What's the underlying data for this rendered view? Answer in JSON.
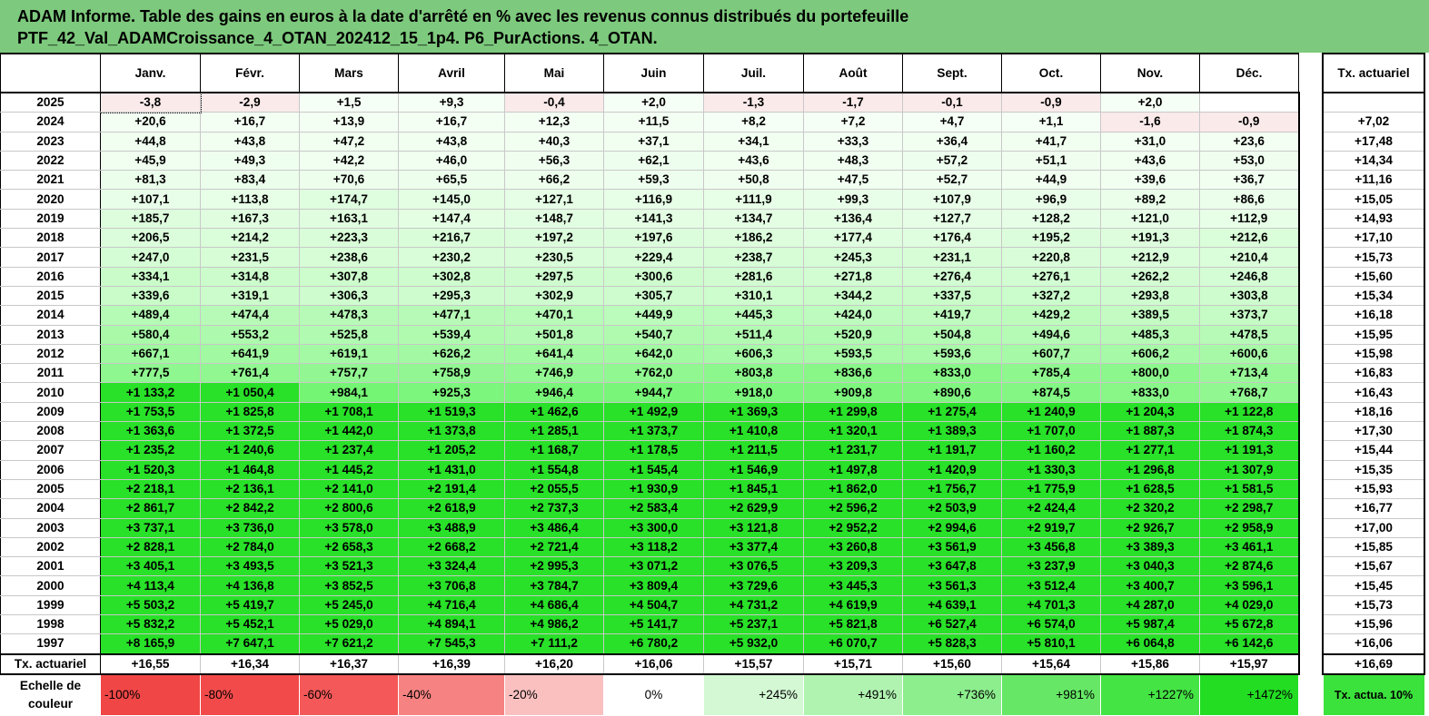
{
  "title": {
    "line1": "ADAM Informe. Table des gains en euros à la date d'arrêté en % avec les revenus connus distribués du portefeuille",
    "line2": "PTF_42_Val_ADAMCroissance_4_OTAN_202412_15_1p4. P6_PurActions. 4_OTAN."
  },
  "months": [
    "Janv.",
    "Févr.",
    "Mars",
    "Avril",
    "Mai",
    "Juin",
    "Juil.",
    "Août",
    "Sept.",
    "Oct.",
    "Nov.",
    "Déc."
  ],
  "rate_header": "Tx. actuariel",
  "rows": [
    {
      "year": "2025",
      "values": [
        "-3,8",
        "-2,9",
        "+1,5",
        "+9,3",
        "-0,4",
        "+2,0",
        "-1,3",
        "-1,7",
        "-0,1",
        "-0,9",
        "+2,0",
        ""
      ],
      "rate": ""
    },
    {
      "year": "2024",
      "values": [
        "+20,6",
        "+16,7",
        "+13,9",
        "+16,7",
        "+12,3",
        "+11,5",
        "+8,2",
        "+7,2",
        "+4,7",
        "+1,1",
        "-1,6",
        "-0,9"
      ],
      "rate": "+7,02"
    },
    {
      "year": "2023",
      "values": [
        "+44,8",
        "+43,8",
        "+47,2",
        "+43,8",
        "+40,3",
        "+37,1",
        "+34,1",
        "+33,3",
        "+36,4",
        "+41,7",
        "+31,0",
        "+23,6"
      ],
      "rate": "+17,48"
    },
    {
      "year": "2022",
      "values": [
        "+45,9",
        "+49,3",
        "+42,2",
        "+46,0",
        "+56,3",
        "+62,1",
        "+43,6",
        "+48,3",
        "+57,2",
        "+51,1",
        "+43,6",
        "+53,0"
      ],
      "rate": "+14,34"
    },
    {
      "year": "2021",
      "values": [
        "+81,3",
        "+83,4",
        "+70,6",
        "+65,5",
        "+66,2",
        "+59,3",
        "+50,8",
        "+47,5",
        "+52,7",
        "+44,9",
        "+39,6",
        "+36,7"
      ],
      "rate": "+11,16"
    },
    {
      "year": "2020",
      "values": [
        "+107,1",
        "+113,8",
        "+174,7",
        "+145,0",
        "+127,1",
        "+116,9",
        "+111,9",
        "+99,3",
        "+107,9",
        "+96,9",
        "+89,2",
        "+86,6"
      ],
      "rate": "+15,05"
    },
    {
      "year": "2019",
      "values": [
        "+185,7",
        "+167,3",
        "+163,1",
        "+147,4",
        "+148,7",
        "+141,3",
        "+134,7",
        "+136,4",
        "+127,7",
        "+128,2",
        "+121,0",
        "+112,9"
      ],
      "rate": "+14,93"
    },
    {
      "year": "2018",
      "values": [
        "+206,5",
        "+214,2",
        "+223,3",
        "+216,7",
        "+197,2",
        "+197,6",
        "+186,2",
        "+177,4",
        "+176,4",
        "+195,2",
        "+191,3",
        "+212,6"
      ],
      "rate": "+17,10"
    },
    {
      "year": "2017",
      "values": [
        "+247,0",
        "+231,5",
        "+238,6",
        "+230,2",
        "+230,5",
        "+229,4",
        "+238,7",
        "+245,3",
        "+231,1",
        "+220,8",
        "+212,9",
        "+210,4"
      ],
      "rate": "+15,73"
    },
    {
      "year": "2016",
      "values": [
        "+334,1",
        "+314,8",
        "+307,8",
        "+302,8",
        "+297,5",
        "+300,6",
        "+281,6",
        "+271,8",
        "+276,4",
        "+276,1",
        "+262,2",
        "+246,8"
      ],
      "rate": "+15,60"
    },
    {
      "year": "2015",
      "values": [
        "+339,6",
        "+319,1",
        "+306,3",
        "+295,3",
        "+302,9",
        "+305,7",
        "+310,1",
        "+344,2",
        "+337,5",
        "+327,2",
        "+293,8",
        "+303,8"
      ],
      "rate": "+15,34"
    },
    {
      "year": "2014",
      "values": [
        "+489,4",
        "+474,4",
        "+478,3",
        "+477,1",
        "+470,1",
        "+449,9",
        "+445,3",
        "+424,0",
        "+419,7",
        "+429,2",
        "+389,5",
        "+373,7"
      ],
      "rate": "+16,18"
    },
    {
      "year": "2013",
      "values": [
        "+580,4",
        "+553,2",
        "+525,8",
        "+539,4",
        "+501,8",
        "+540,7",
        "+511,4",
        "+520,9",
        "+504,8",
        "+494,6",
        "+485,3",
        "+478,5"
      ],
      "rate": "+15,95"
    },
    {
      "year": "2012",
      "values": [
        "+667,1",
        "+641,9",
        "+619,1",
        "+626,2",
        "+641,4",
        "+642,0",
        "+606,3",
        "+593,5",
        "+593,6",
        "+607,7",
        "+606,2",
        "+600,6"
      ],
      "rate": "+15,98"
    },
    {
      "year": "2011",
      "values": [
        "+777,5",
        "+761,4",
        "+757,7",
        "+758,9",
        "+746,9",
        "+762,0",
        "+803,8",
        "+836,6",
        "+833,0",
        "+785,4",
        "+800,0",
        "+713,4"
      ],
      "rate": "+16,83"
    },
    {
      "year": "2010",
      "values": [
        "+1 133,2",
        "+1 050,4",
        "+984,1",
        "+925,3",
        "+946,4",
        "+944,7",
        "+918,0",
        "+909,8",
        "+890,6",
        "+874,5",
        "+833,0",
        "+768,7"
      ],
      "rate": "+16,43"
    },
    {
      "year": "2009",
      "values": [
        "+1 753,5",
        "+1 825,8",
        "+1 708,1",
        "+1 519,3",
        "+1 462,6",
        "+1 492,9",
        "+1 369,3",
        "+1 299,8",
        "+1 275,4",
        "+1 240,9",
        "+1 204,3",
        "+1 122,8"
      ],
      "rate": "+18,16"
    },
    {
      "year": "2008",
      "values": [
        "+1 363,6",
        "+1 372,5",
        "+1 442,0",
        "+1 373,8",
        "+1 285,1",
        "+1 373,7",
        "+1 410,8",
        "+1 320,1",
        "+1 389,3",
        "+1 707,0",
        "+1 887,3",
        "+1 874,3"
      ],
      "rate": "+17,30"
    },
    {
      "year": "2007",
      "values": [
        "+1 235,2",
        "+1 240,6",
        "+1 237,4",
        "+1 205,2",
        "+1 168,7",
        "+1 178,5",
        "+1 211,5",
        "+1 231,7",
        "+1 191,7",
        "+1 160,2",
        "+1 277,1",
        "+1 191,3"
      ],
      "rate": "+15,44"
    },
    {
      "year": "2006",
      "values": [
        "+1 520,3",
        "+1 464,8",
        "+1 445,2",
        "+1 431,0",
        "+1 554,8",
        "+1 545,4",
        "+1 546,9",
        "+1 497,8",
        "+1 420,9",
        "+1 330,3",
        "+1 296,8",
        "+1 307,9"
      ],
      "rate": "+15,35"
    },
    {
      "year": "2005",
      "values": [
        "+2 218,1",
        "+2 136,1",
        "+2 141,0",
        "+2 191,4",
        "+2 055,5",
        "+1 930,9",
        "+1 845,1",
        "+1 862,0",
        "+1 756,7",
        "+1 775,9",
        "+1 628,5",
        "+1 581,5"
      ],
      "rate": "+15,93"
    },
    {
      "year": "2004",
      "values": [
        "+2 861,7",
        "+2 842,2",
        "+2 800,6",
        "+2 618,9",
        "+2 737,3",
        "+2 583,4",
        "+2 629,9",
        "+2 596,2",
        "+2 503,9",
        "+2 424,4",
        "+2 320,2",
        "+2 298,7"
      ],
      "rate": "+16,77"
    },
    {
      "year": "2003",
      "values": [
        "+3 737,1",
        "+3 736,0",
        "+3 578,0",
        "+3 488,9",
        "+3 486,4",
        "+3 300,0",
        "+3 121,8",
        "+2 952,2",
        "+2 994,6",
        "+2 919,7",
        "+2 926,7",
        "+2 958,9"
      ],
      "rate": "+17,00"
    },
    {
      "year": "2002",
      "values": [
        "+2 828,1",
        "+2 784,0",
        "+2 658,3",
        "+2 668,2",
        "+2 721,4",
        "+3 118,2",
        "+3 377,4",
        "+3 260,8",
        "+3 561,9",
        "+3 456,8",
        "+3 389,3",
        "+3 461,1"
      ],
      "rate": "+15,85"
    },
    {
      "year": "2001",
      "values": [
        "+3 405,1",
        "+3 493,5",
        "+3 521,3",
        "+3 324,4",
        "+2 995,3",
        "+3 071,2",
        "+3 076,5",
        "+3 209,3",
        "+3 647,8",
        "+3 237,9",
        "+3 040,3",
        "+2 874,6"
      ],
      "rate": "+15,67"
    },
    {
      "year": "2000",
      "values": [
        "+4 113,4",
        "+4 136,8",
        "+3 852,5",
        "+3 706,8",
        "+3 784,7",
        "+3 809,4",
        "+3 729,6",
        "+3 445,3",
        "+3 561,3",
        "+3 512,4",
        "+3 400,7",
        "+3 596,1"
      ],
      "rate": "+15,45"
    },
    {
      "year": "1999",
      "values": [
        "+5 503,2",
        "+5 419,7",
        "+5 245,0",
        "+4 716,4",
        "+4 686,4",
        "+4 504,7",
        "+4 731,2",
        "+4 619,9",
        "+4 639,1",
        "+4 701,3",
        "+4 287,0",
        "+4 029,0"
      ],
      "rate": "+15,73"
    },
    {
      "year": "1998",
      "values": [
        "+5 832,2",
        "+5 452,1",
        "+5 029,0",
        "+4 894,1",
        "+4 986,2",
        "+5 141,7",
        "+5 237,1",
        "+5 821,8",
        "+6 527,4",
        "+6 574,0",
        "+5 987,4",
        "+5 672,8"
      ],
      "rate": "+15,96"
    },
    {
      "year": "1997",
      "values": [
        "+8 165,9",
        "+7 647,1",
        "+7 621,2",
        "+7 545,3",
        "+7 111,2",
        "+6 780,2",
        "+5 932,0",
        "+6 070,7",
        "+5 828,3",
        "+5 810,1",
        "+6 064,8",
        "+6 142,6"
      ],
      "rate": "+16,06"
    }
  ],
  "summary": {
    "label": "Tx. actuariel",
    "values": [
      "+16,55",
      "+16,34",
      "+16,37",
      "+16,39",
      "+16,20",
      "+16,06",
      "+15,57",
      "+15,71",
      "+15,60",
      "+15,64",
      "+15,86",
      "+15,97"
    ],
    "rate": "+16,69"
  },
  "scale": {
    "label": "Echelle de couleur",
    "items": [
      {
        "text": "-100%",
        "color": "#f04646"
      },
      {
        "text": "-80%",
        "color": "#f24a4a"
      },
      {
        "text": "-60%",
        "color": "#f45858"
      },
      {
        "text": "-40%",
        "color": "#f78282"
      },
      {
        "text": "-20%",
        "color": "#fac0c0"
      },
      {
        "text": "0%",
        "color": "#ffffff"
      },
      {
        "text": "+245%",
        "color": "#d3f8d3"
      },
      {
        "text": "+491%",
        "color": "#b0f3b0"
      },
      {
        "text": "+736%",
        "color": "#8cee8c"
      },
      {
        "text": "+981%",
        "color": "#66e866"
      },
      {
        "text": "+1227%",
        "color": "#44e444"
      },
      {
        "text": "+1472%",
        "color": "#22dd22"
      }
    ],
    "rate_label": "Tx. actua. 10%"
  },
  "colors": {
    "header_bg": "#7dc97d",
    "rate_scale_bg": "#3ce23c"
  }
}
